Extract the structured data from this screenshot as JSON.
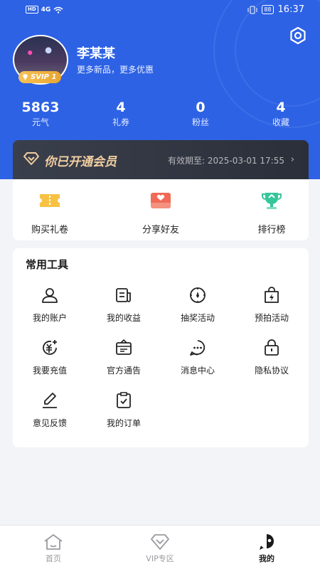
{
  "statusbar": {
    "network": "4G",
    "battery": "88",
    "time": "16:37",
    "hd": "HD"
  },
  "profile": {
    "name": "李某某",
    "subtitle": "更多新品，更多优惠",
    "vip_level": "SVIP 1"
  },
  "stats": [
    {
      "value": "5863",
      "label": "元气"
    },
    {
      "value": "4",
      "label": "礼券"
    },
    {
      "value": "0",
      "label": "粉丝"
    },
    {
      "value": "4",
      "label": "收藏"
    }
  ],
  "vip_bar": {
    "title": "你已开通会员",
    "expire": "有效期至: 2025-03-01 17:55",
    "arrow": "›"
  },
  "quick_actions": [
    {
      "label": "购买礼卷",
      "icon": "ticket-icon",
      "color": "#f5b63a"
    },
    {
      "label": "分享好友",
      "icon": "share-heart-icon",
      "color": "#f06a57"
    },
    {
      "label": "排行榜",
      "icon": "trophy-icon",
      "color": "#35c79a"
    }
  ],
  "tools": {
    "title": "常用工具",
    "items": [
      {
        "label": "我的账户",
        "icon": "user-icon"
      },
      {
        "label": "我的收益",
        "icon": "earnings-icon"
      },
      {
        "label": "抽奖活动",
        "icon": "lottery-icon"
      },
      {
        "label": "预拍活动",
        "icon": "presale-bag-icon"
      },
      {
        "label": "我要充值",
        "icon": "recharge-icon"
      },
      {
        "label": "官方通告",
        "icon": "notice-icon"
      },
      {
        "label": "消息中心",
        "icon": "message-icon"
      },
      {
        "label": "隐私协议",
        "icon": "privacy-lock-icon"
      },
      {
        "label": "意见反馈",
        "icon": "feedback-pen-icon"
      },
      {
        "label": "我的订单",
        "icon": "order-icon"
      }
    ]
  },
  "tabbar": [
    {
      "label": "首页",
      "icon": "home-icon",
      "active": false
    },
    {
      "label": "VIP专区",
      "icon": "vip-diamond-icon",
      "active": false
    },
    {
      "label": "我的",
      "icon": "profile-face-icon",
      "active": true
    }
  ],
  "colors": {
    "primary": "#2d62e5",
    "vip_gold": "#f2cfa0",
    "inactive": "#9a9aa0"
  }
}
